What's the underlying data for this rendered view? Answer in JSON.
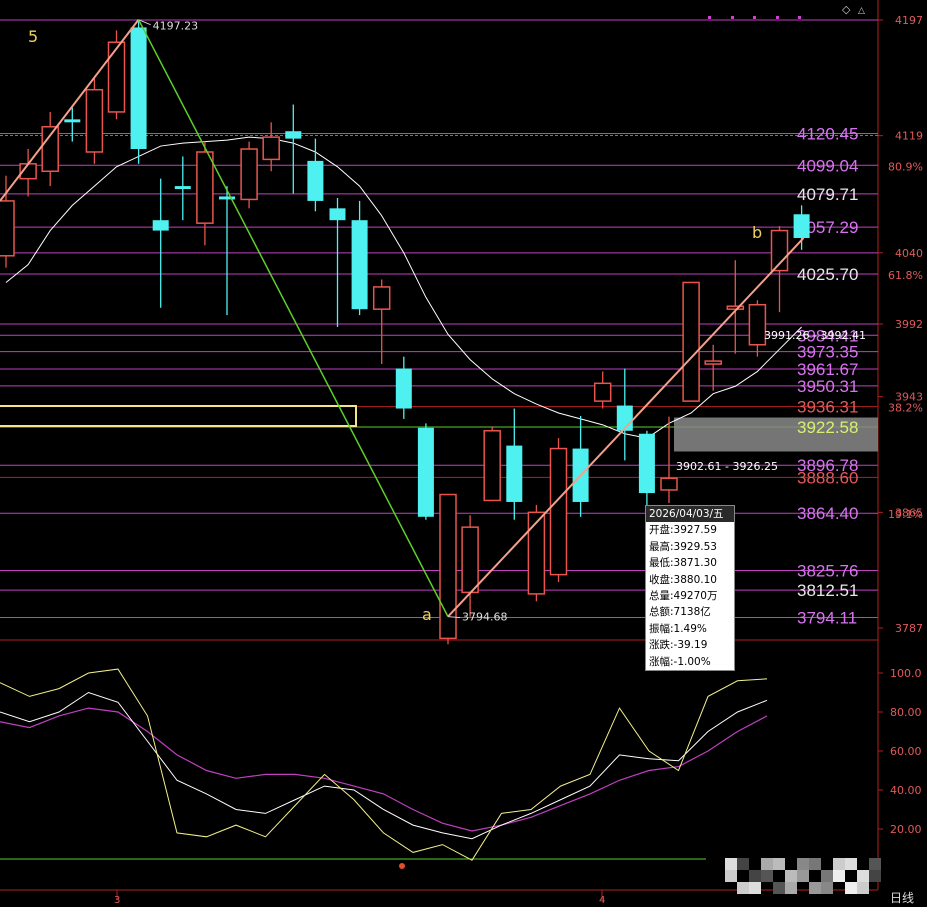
{
  "chart_data": {
    "type": "candlestick",
    "price_range": [
      3787,
      4210
    ],
    "indicator_range": [
      10,
      110
    ],
    "colors": {
      "up": "#e8554e",
      "down": "#4ff0f0",
      "ma": "#ffffff",
      "level_line": "#c040c0",
      "level_label": "#d873f0",
      "wave_green": "#5cd02a",
      "wave_salmon": "#f4a08a",
      "wave_label": "#f0d060",
      "yellow_box": "#f4e48a",
      "indicator_k": "#f4f08a",
      "indicator_d": "#ffffff",
      "indicator_j": "#c040c0"
    },
    "candles": [
      {
        "o": 4038,
        "c": 4075,
        "h": 4092,
        "l": 4030
      },
      {
        "o": 4090,
        "c": 4100,
        "h": 4110,
        "l": 4078
      },
      {
        "o": 4095,
        "c": 4125,
        "h": 4135,
        "l": 4085
      },
      {
        "o": 4130,
        "c": 4128,
        "h": 4138,
        "l": 4115
      },
      {
        "o": 4108,
        "c": 4150,
        "h": 4158,
        "l": 4100
      },
      {
        "o": 4135,
        "c": 4182,
        "h": 4190,
        "l": 4130
      },
      {
        "o": 4192,
        "c": 4110,
        "h": 4197.23,
        "l": 4100
      },
      {
        "o": 4062,
        "c": 4055,
        "h": 4090,
        "l": 4003
      },
      {
        "o": 4085,
        "c": 4083,
        "h": 4105,
        "l": 4062
      },
      {
        "o": 4060,
        "c": 4108,
        "h": 4115,
        "l": 4045
      },
      {
        "o": 4078,
        "c": 4076,
        "h": 4085,
        "l": 3998
      },
      {
        "o": 4076,
        "c": 4110,
        "h": 4115,
        "l": 4070
      },
      {
        "o": 4103,
        "c": 4118,
        "h": 4128,
        "l": 4095
      },
      {
        "o": 4122,
        "c": 4117,
        "h": 4140,
        "l": 4080
      },
      {
        "o": 4102,
        "c": 4075,
        "h": 4117,
        "l": 4068
      },
      {
        "o": 4070,
        "c": 4062,
        "h": 4077,
        "l": 3990
      },
      {
        "o": 4062,
        "c": 4002,
        "h": 4075,
        "l": 3998
      },
      {
        "o": 4002,
        "c": 4017,
        "h": 4022,
        "l": 3965
      },
      {
        "o": 3962,
        "c": 3935,
        "h": 3970,
        "l": 3928
      },
      {
        "o": 3922,
        "c": 3862,
        "h": 3925,
        "l": 3860
      },
      {
        "o": 3780,
        "c": 3877,
        "h": 3877,
        "l": 3776
      },
      {
        "o": 3811,
        "c": 3855,
        "h": 3863,
        "l": 3794.68
      },
      {
        "o": 3873,
        "c": 3920,
        "h": 3923,
        "l": 3873
      },
      {
        "o": 3910,
        "c": 3872,
        "h": 3935,
        "l": 3860
      },
      {
        "o": 3810,
        "c": 3865,
        "h": 3870,
        "l": 3805
      },
      {
        "o": 3823,
        "c": 3908,
        "h": 3915,
        "l": 3818
      },
      {
        "o": 3908,
        "c": 3872,
        "h": 3930,
        "l": 3862
      },
      {
        "o": 3940,
        "c": 3952,
        "h": 3960,
        "l": 3935
      },
      {
        "o": 3937,
        "c": 3920,
        "h": 3962,
        "l": 3900
      },
      {
        "o": 3918,
        "c": 3878,
        "h": 3920,
        "l": 3868
      },
      {
        "o": 3880.1,
        "c": 3888,
        "h": 3929.53,
        "l": 3871.3
      },
      {
        "o": 3940,
        "c": 4020,
        "h": 4020,
        "l": 3940
      },
      {
        "o": 3965,
        "c": 3967,
        "h": 3978,
        "l": 3947
      },
      {
        "o": 4002,
        "c": 4004,
        "h": 4035,
        "l": 3972
      },
      {
        "o": 3978,
        "c": 4005,
        "h": 4008,
        "l": 3970
      },
      {
        "o": 4028,
        "c": 4055,
        "h": 4058,
        "l": 4000
      },
      {
        "o": 4066,
        "c": 4050,
        "h": 4072,
        "l": 4042
      }
    ],
    "ma_line": [
      4020,
      4032,
      4055,
      4072,
      4085,
      4098,
      4105,
      4112,
      4114,
      4115,
      4116,
      4118,
      4117,
      4114,
      4108,
      4098,
      4085,
      4065,
      4040,
      4010,
      3985,
      3968,
      3955,
      3945,
      3938,
      3932,
      3928,
      3924,
      3918,
      3915,
      3925,
      3932,
      3945,
      3950,
      3960,
      3975,
      3990
    ],
    "price_axis_labels": [
      "4197",
      "4119",
      "4040",
      "3992",
      "3943",
      "3865",
      "3787"
    ],
    "percent_labels": [
      "80.9%",
      "61.8%",
      "38.2%",
      "19.1%"
    ],
    "levels": [
      {
        "value": 4197,
        "label": ""
      },
      {
        "value": 4120.45,
        "label": "4120.45"
      },
      {
        "value": 4099.04,
        "label": "4099.04"
      },
      {
        "value": 4079.71,
        "label": "4079.71"
      },
      {
        "value": 4057.29,
        "label": "4057.29"
      },
      {
        "value": 4040,
        "label": ""
      },
      {
        "value": 4025.7,
        "label": "4025.70"
      },
      {
        "value": 3992,
        "label": ""
      },
      {
        "value": 3984.4,
        "label": "3984.41"
      },
      {
        "value": 3973.35,
        "label": "3973.35"
      },
      {
        "value": 3961.67,
        "label": "3961.67"
      },
      {
        "value": 3950.31,
        "label": "3950.31"
      },
      {
        "value": 3936.31,
        "label": "3936.31"
      },
      {
        "value": 3922.58,
        "label": "3922.58"
      },
      {
        "value": 3896.78,
        "label": "3896.78"
      },
      {
        "value": 3888.6,
        "label": "3888.60"
      },
      {
        "value": 3864.4,
        "label": "3864.40"
      },
      {
        "value": 3825.76,
        "label": "3825.76"
      },
      {
        "value": 3812.51,
        "label": "3812.51"
      },
      {
        "value": 3794.11,
        "label": "3794.11"
      }
    ],
    "annotations": {
      "high_label": "4197.23",
      "low_label": "3794.68",
      "gap_label": "3902.61 - 3926.25",
      "range2_label": "3991.26 - 3992.41",
      "wave_5": "5",
      "wave_a": "a",
      "wave_b": "b",
      "x_tick_3": "3",
      "x_tick_4": "4",
      "period": "日线"
    },
    "indicator_axis_labels": [
      "100.0",
      "80.00",
      "60.00",
      "40.00",
      "20.00"
    ],
    "indicator_k": [
      95,
      88,
      92,
      100,
      102,
      78,
      18,
      16,
      22,
      16,
      32,
      48,
      35,
      18,
      8,
      12,
      4,
      28,
      30,
      42,
      48,
      82,
      60,
      50,
      88,
      96,
      97
    ],
    "indicator_d": [
      80,
      75,
      80,
      90,
      85,
      65,
      45,
      38,
      30,
      28,
      35,
      42,
      40,
      30,
      22,
      18,
      15,
      22,
      28,
      35,
      42,
      58,
      56,
      55,
      70,
      80,
      86
    ],
    "indicator_j": [
      75,
      72,
      78,
      82,
      80,
      70,
      58,
      50,
      46,
      48,
      48,
      46,
      42,
      38,
      30,
      23,
      19,
      22,
      26,
      32,
      38,
      45,
      50,
      52,
      60,
      70,
      78
    ]
  },
  "info_box": {
    "date": "2026/04/03/五",
    "rows": [
      "开盘:3927.59",
      "最高:3929.53",
      "最低:3871.30",
      "收盘:3880.10",
      "总量:49270万",
      "总额:7138亿",
      "振幅:1.49%",
      "涨跌:-39.19",
      "涨幅:-1.00%"
    ]
  }
}
